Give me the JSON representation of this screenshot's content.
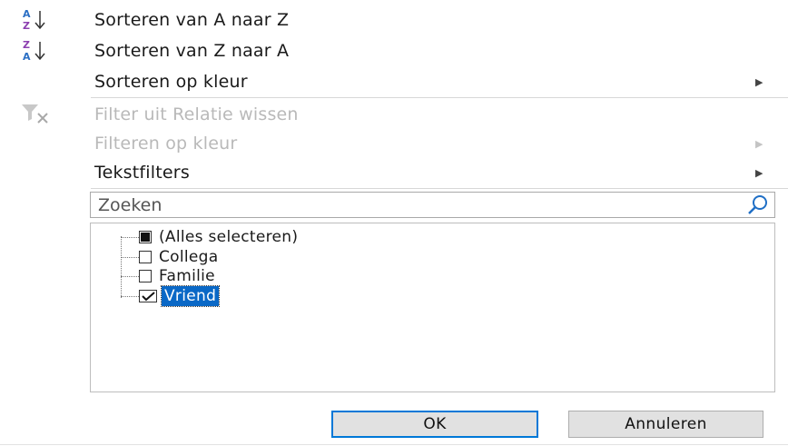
{
  "menu": {
    "sort_az": "Sorteren van A naar Z",
    "sort_za": "Sorteren van Z naar A",
    "sort_color": "Sorteren op kleur",
    "clear_filter": "Filter uit Relatie wissen",
    "filter_color": "Filteren op kleur",
    "text_filters": "Tekstfilters"
  },
  "search": {
    "placeholder": "Zoeken"
  },
  "list": {
    "items": [
      {
        "label": "(Alles selecteren)",
        "state": "partial"
      },
      {
        "label": "Collega",
        "state": "unchecked"
      },
      {
        "label": "Familie",
        "state": "unchecked"
      },
      {
        "label": "Vriend",
        "state": "checked",
        "selected": true
      }
    ]
  },
  "buttons": {
    "ok": "OK",
    "cancel": "Annuleren"
  },
  "icons": {
    "sort_az": "sort-ascending-icon",
    "sort_za": "sort-descending-icon",
    "clear_filter": "clear-filter-icon",
    "search": "search-icon",
    "submenu": "submenu-arrow-icon"
  },
  "colors": {
    "accent": "#0078d7",
    "selection": "#0a68c6",
    "disabled_text": "#b9b9b9"
  }
}
